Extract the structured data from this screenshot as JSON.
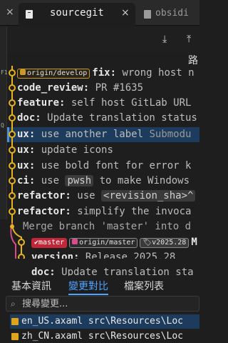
{
  "tabs": {
    "active_title": "sourcegit",
    "active_close": "×",
    "other_title": "obsidi",
    "left_close": "×"
  },
  "toolbar": {
    "download_icon": "⤓",
    "upload_icon": "⤒"
  },
  "corner_text": "路",
  "left_strip": [
    "F1",
    "Q"
  ],
  "commits": [
    {
      "tags": [
        {
          "label": "origin/develop",
          "style": "yellow"
        }
      ],
      "title": "fix:",
      "rest": " wrong host n"
    },
    {
      "title": "code_review:",
      "rest": " PR #1635"
    },
    {
      "title": "feature:",
      "rest": " self host GitLab URL"
    },
    {
      "title": "doc:",
      "rest": " Update translation status"
    },
    {
      "title": "ux:",
      "rest": " use another label ",
      "extra": "Submodu",
      "selected": true
    },
    {
      "title": "ux:",
      "rest": " update icons"
    },
    {
      "title": "ux:",
      "rest": " use bold font for error k"
    },
    {
      "title": "ci:",
      "rest": " use ",
      "code": "pwsh",
      "rest2": " to make Windows"
    },
    {
      "title": "refactor:",
      "rest": " use ",
      "code": "<revision_sha>^"
    },
    {
      "title": "refactor:",
      "rest": " simplify the invoca"
    },
    {
      "plain": "Merge branch 'master' into d"
    },
    {
      "tags": [
        {
          "label": "master",
          "style": "red"
        },
        {
          "label": "origin/master",
          "style": "dark"
        },
        {
          "label": "v2025.28",
          "style": "gray"
        }
      ],
      "title": "M"
    },
    {
      "title": "version:",
      "rest": " Release 2025.28"
    },
    {
      "title": "doc:",
      "rest": " Update translation sta"
    }
  ],
  "panel_tabs": [
    "基本資訊",
    "變更對比",
    "檔案列表"
  ],
  "active_panel_tab": 1,
  "search": {
    "placeholder": "搜尋變更..."
  },
  "files": [
    {
      "path": "en_US.axaml src\\Resources\\Loc"
    },
    {
      "path": "zh_CN.axaml src\\Resources\\Loc"
    }
  ],
  "colors": {
    "accent": "#4fa3ff",
    "graph_yellow": "#e6b31e",
    "graph_pink": "#d94c8c",
    "selected_row": "#1d3b5c"
  }
}
